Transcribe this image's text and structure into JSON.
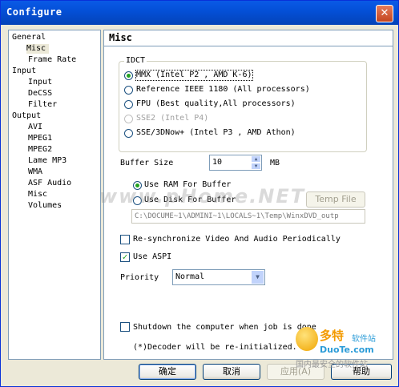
{
  "window": {
    "title": "Configure",
    "close_glyph": "✕"
  },
  "tree": {
    "items": [
      {
        "label": "General",
        "level": 0
      },
      {
        "label": "Misc",
        "level": 1,
        "selected": true
      },
      {
        "label": "Frame Rate",
        "level": 1
      },
      {
        "label": "Input",
        "level": 0
      },
      {
        "label": "Input",
        "level": 1
      },
      {
        "label": "DeCSS",
        "level": 1
      },
      {
        "label": "Filter",
        "level": 1
      },
      {
        "label": "Output",
        "level": 0
      },
      {
        "label": "AVI",
        "level": 1
      },
      {
        "label": "MPEG1",
        "level": 1
      },
      {
        "label": "MPEG2",
        "level": 1
      },
      {
        "label": "Lame MP3",
        "level": 1
      },
      {
        "label": "WMA",
        "level": 1
      },
      {
        "label": "ASF Audio",
        "level": 1
      },
      {
        "label": "Misc",
        "level": 1
      },
      {
        "label": "Volumes",
        "level": 1
      }
    ]
  },
  "panel": {
    "title": "Misc",
    "idct": {
      "title": "IDCT",
      "options": [
        {
          "label": "MMX (Intel P2 , AMD K-6)",
          "selected": true,
          "disabled": false
        },
        {
          "label": "Reference IEEE 1180 (All processors)",
          "selected": false,
          "disabled": false
        },
        {
          "label": "FPU (Best quality,All processors)",
          "selected": false,
          "disabled": false
        },
        {
          "label": "SSE2 (Intel P4)",
          "selected": false,
          "disabled": true
        },
        {
          "label": "SSE/3DNow+ (Intel P3 , AMD Athon)",
          "selected": false,
          "disabled": false
        }
      ]
    },
    "buffer": {
      "label": "Buffer Size",
      "value": "10",
      "unit": "MB",
      "up": "▲",
      "down": "▼"
    },
    "buffer_mode": {
      "ram_label": "Use RAM For Buffer",
      "disk_label": "Use Disk For Buffer",
      "ram_selected": true,
      "temp_button": "Temp File",
      "temp_path": "C:\\DOCUME~1\\ADMINI~1\\LOCALS~1\\Temp\\WinxDVD_outp"
    },
    "resync": {
      "label": "Re-synchronize Video And Audio Periodically",
      "checked": false
    },
    "aspi": {
      "label": "Use ASPI",
      "checked": true
    },
    "priority": {
      "label": "Priority",
      "value": "Normal",
      "arrow": "▼"
    },
    "shutdown": {
      "label": "Shutdown the computer when job is done",
      "checked": false
    },
    "note": "(*)Decoder will be re-initialized."
  },
  "buttons": {
    "ok": "确定",
    "cancel": "取消",
    "apply": "应用(A)",
    "help": "帮助"
  },
  "watermark": "www.pHome.NET",
  "logo": {
    "cn": "多特",
    "sub": "软件站",
    "en": "DuoTe.com",
    "cn2": "国内最安全的软件站"
  },
  "colors": {
    "titlebar": "#0450d8",
    "face": "#ece9d8",
    "accent_check": "#21a121",
    "logo_orange": "#f39a00",
    "logo_blue": "#2b9cd8"
  }
}
